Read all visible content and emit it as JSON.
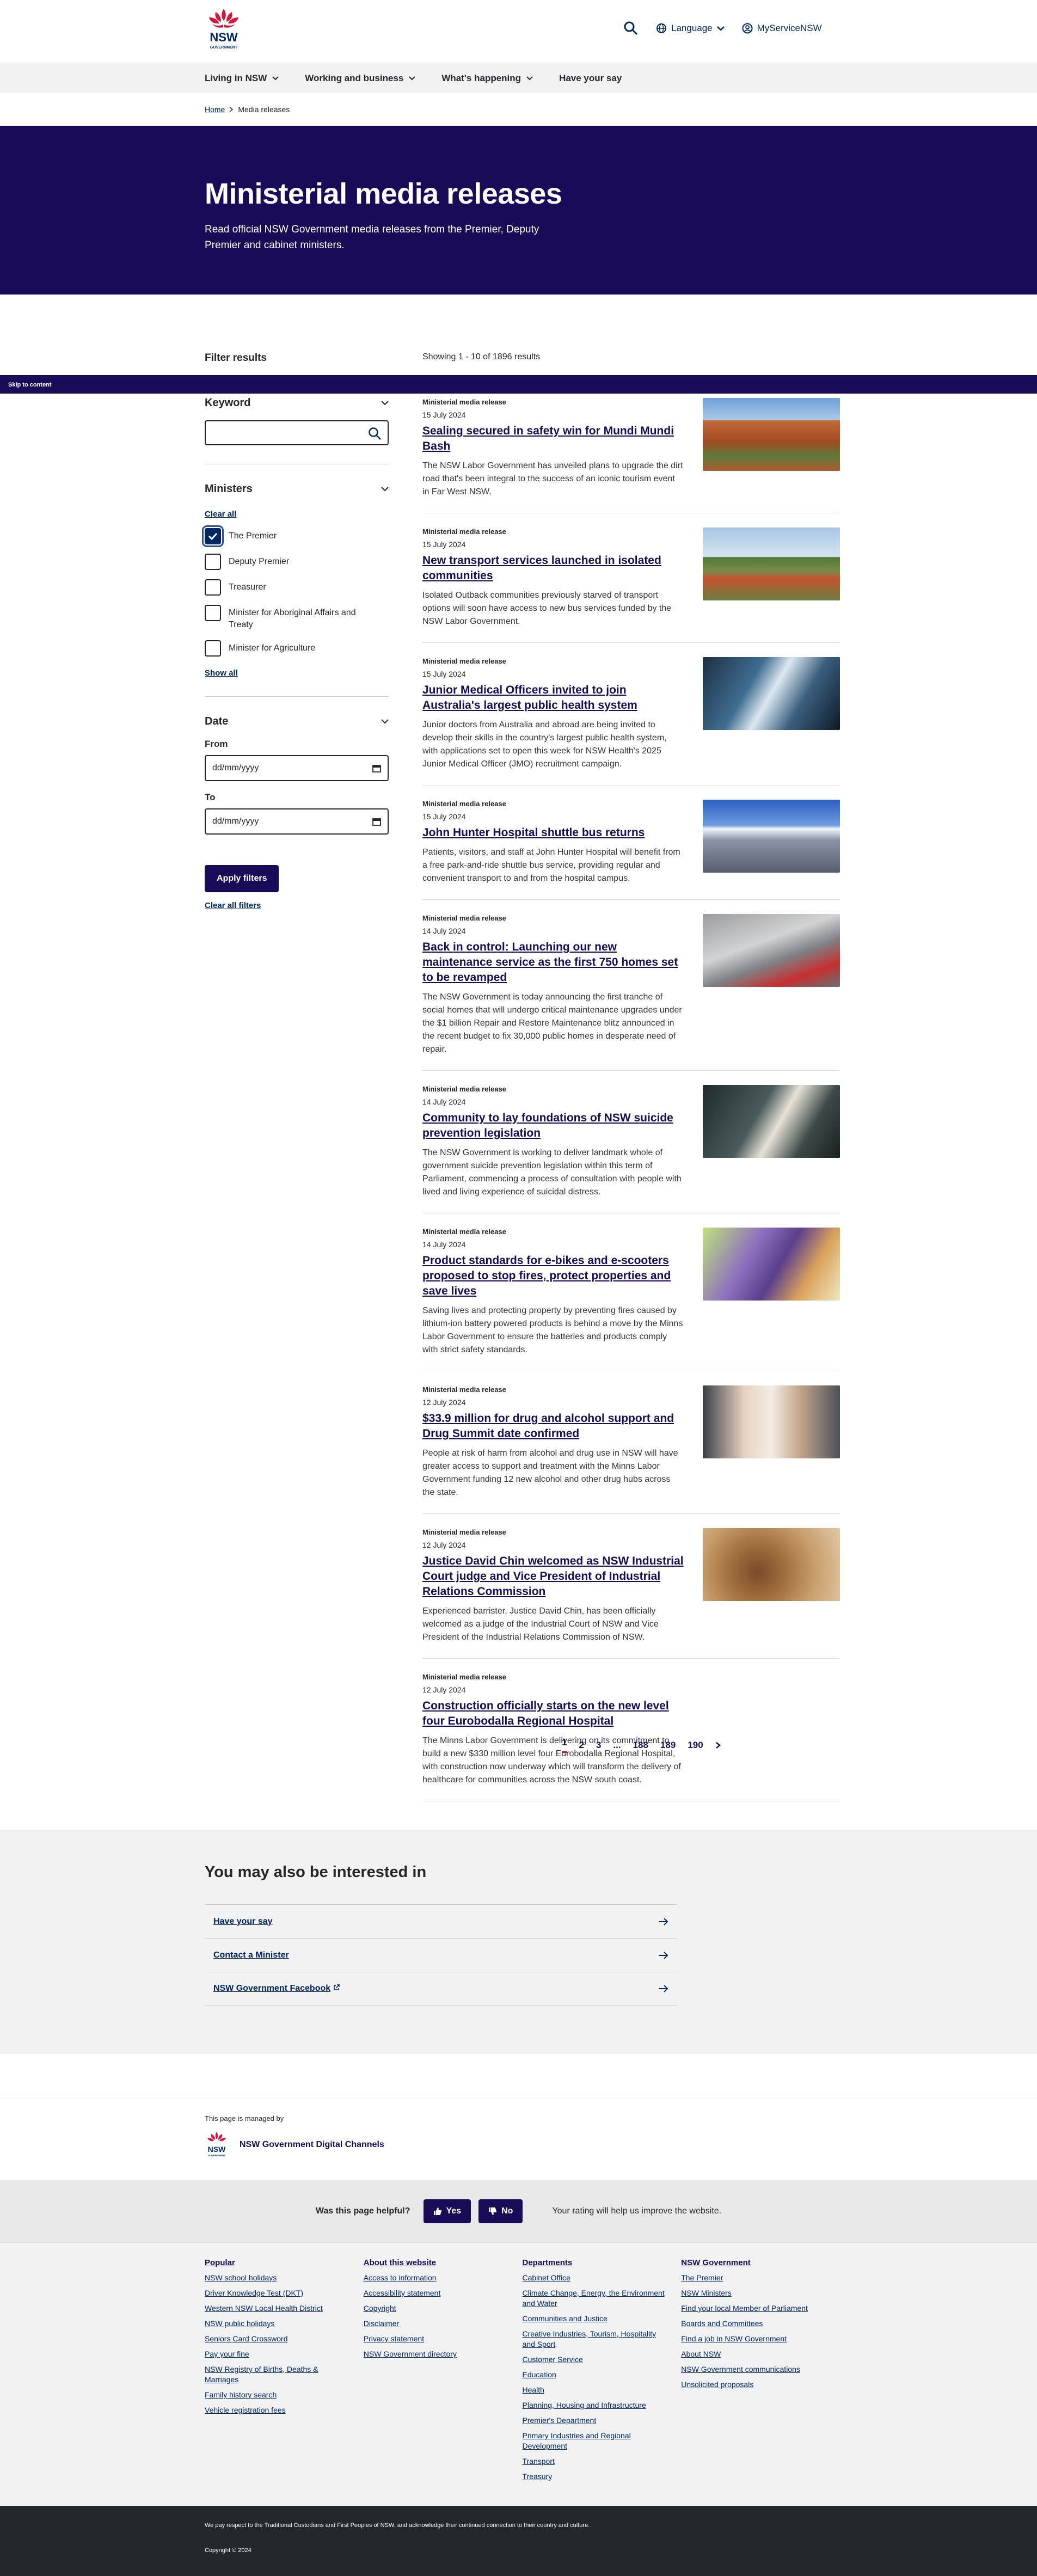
{
  "header": {
    "logo_text": "NSW",
    "logo_sub": "GOVERNMENT",
    "language": "Language",
    "my_service": "MyServiceNSW"
  },
  "nav": {
    "items": [
      "Living in NSW",
      "Working and business",
      "What's happening",
      "Have your say"
    ]
  },
  "breadcrumb": {
    "home": "Home",
    "current": "Media releases"
  },
  "hero": {
    "title": "Ministerial media releases",
    "lead": "Read official NSW Government media releases from the Premier, Deputy Premier and cabinet ministers."
  },
  "skip": "Skip to content",
  "filters": {
    "title": "Filter results",
    "keyword": "Keyword",
    "ministers": "Ministers",
    "clear_all": "Clear all",
    "options": [
      "The Premier",
      "Deputy Premier",
      "Treasurer",
      "Minister for Aboriginal Affairs and Treaty",
      "Minister for Agriculture"
    ],
    "show_all": "Show all",
    "date": "Date",
    "from": "From",
    "to": "To",
    "date_placeholder": "dd/mm/yyyy",
    "apply": "Apply filters",
    "clear_filters": "Clear all filters"
  },
  "showing": "Showing 1 - 10 of 1896 results",
  "results": [
    {
      "type": "Ministerial media release",
      "date": "15 July 2024",
      "title": "Sealing secured in safety win for Mundi Mundi Bash",
      "summary": "The NSW Labor Government has unveiled plans to upgrade the dirt road that's been integral to the success of an iconic tourism event in Far West NSW.",
      "img": "outback"
    },
    {
      "type": "Ministerial media release",
      "date": "15 July 2024",
      "title": "New transport services launched in isolated communities",
      "summary": "Isolated Outback communities previously starved of transport options will soon have access to new bus services funded by the NSW Labor Government.",
      "img": "road"
    },
    {
      "type": "Ministerial media release",
      "date": "15 July 2024",
      "title": "Junior Medical Officers invited to join Australia's largest public health system",
      "summary": "Junior doctors from Australia and abroad are being invited to develop their skills in the country's largest public health system, with applications set to open this week for NSW Health's 2025 Junior Medical Officer (JMO) recruitment campaign.",
      "img": "xray"
    },
    {
      "type": "Ministerial media release",
      "date": "15 July 2024",
      "title": "John Hunter Hospital shuttle bus returns",
      "summary": "Patients, visitors, and staff at John Hunter Hospital will benefit from a free park-and-ride shuttle bus service, providing regular and convenient transport to and from the hospital campus.",
      "img": "hospital"
    },
    {
      "type": "Ministerial media release",
      "date": "14 July 2024",
      "title": "Back in control: Launching our new maintenance service as the first 750 homes set to be revamped",
      "summary": "The NSW Government is today announcing the first tranche of social homes that will undergo critical maintenance upgrades under the $1 billion Repair and Restore Maintenance blitz announced in the recent budget to fix 30,000 public homes in desperate need of repair.",
      "img": "ceiling"
    },
    {
      "type": "Ministerial media release",
      "date": "14 July 2024",
      "title": "Community to lay foundations of NSW suicide prevention legislation",
      "summary": "The NSW Government is working to deliver landmark whole of government suicide prevention legislation within this term of Parliament, commencing a process of consultation with people with lived and living experience of suicidal distress.",
      "img": "coffee"
    },
    {
      "type": "Ministerial media release",
      "date": "14 July 2024",
      "title": "Product standards for e-bikes and e-scooters proposed to stop fires, protect properties and save lives",
      "summary": "Saving lives and protecting property by preventing fires caused by lithium-ion battery powered products is behind a move by the Minns Labor Government to ensure the batteries and products comply with strict safety standards.",
      "img": "bike"
    },
    {
      "type": "Ministerial media release",
      "date": "12 July 2024",
      "title": "$33.9 million for drug and alcohol support and Drug Summit date confirmed",
      "summary": "People at risk of harm from alcohol and drug use in NSW will have greater access to support and treatment with the Minns Labor Government funding 12 new alcohol and other drug hubs across the state.",
      "img": "support"
    },
    {
      "type": "Ministerial media release",
      "date": "12 July 2024",
      "title": "Justice David Chin welcomed as NSW Industrial Court judge and Vice President of Industrial Relations Commission",
      "summary": "Experienced barrister, Justice David Chin, has been officially welcomed as a judge of the Industrial Court of NSW and Vice President of the Industrial Relations Commission of NSW.",
      "img": "gavel"
    },
    {
      "type": "Ministerial media release",
      "date": "12 July 2024",
      "title": "Construction officially starts on the new level four Eurobodalla Regional Hospital",
      "summary": "The Minns Labor Government is delivering on its commitment to build a new $330 million level four Eurobodalla Regional Hospital, with construction now underway which will transform the delivery of healthcare for communities across the NSW south coast.",
      "img": ""
    }
  ],
  "pager": [
    "1",
    "2",
    "3",
    "...",
    "188",
    "189",
    "190"
  ],
  "interested": {
    "title": "You may also be interested in",
    "links": [
      "Have your say",
      "Contact a Minister",
      "NSW Government Facebook"
    ]
  },
  "managed": {
    "label": "This page is managed by",
    "org": "NSW Government Digital Channels"
  },
  "helpful": {
    "question": "Was this page helpful?",
    "yes": "Yes",
    "no": "No",
    "message": "Your rating will help us improve the website."
  },
  "footer": {
    "cols": [
      {
        "title": "Popular",
        "links": [
          "NSW school holidays",
          "Driver Knowledge Test (DKT)",
          "Western NSW Local Health District",
          "NSW public holidays",
          "Seniors Card Crossword",
          "Pay your fine",
          "NSW Registry of Births, Deaths & Marriages",
          "Family history search",
          "Vehicle registration fees"
        ]
      },
      {
        "title": "About this website",
        "links": [
          "Access to information",
          "Accessibility statement",
          "Copyright",
          "Disclaimer",
          "Privacy statement",
          "NSW Government directory"
        ]
      },
      {
        "title": "Departments",
        "links": [
          "Cabinet Office",
          "Climate Change, Energy, the Environment and Water",
          "Communities and Justice",
          "Creative Industries, Tourism, Hospitality and Sport",
          "Customer Service",
          "Education",
          "Health",
          "Planning, Housing and Infrastructure",
          "Premier's Department",
          "Primary Industries and Regional Development",
          "Transport",
          "Treasury"
        ]
      },
      {
        "title": "NSW Government",
        "links": [
          "The Premier",
          "NSW Ministers",
          "Find your local Member of Parliament",
          "Boards and Committees",
          "Find a job in NSW Government",
          "About NSW",
          "NSW Government communications",
          "Unsolicited proposals"
        ]
      }
    ],
    "acknowledgement": "We pay respect to the Traditional Custodians and First Peoples of NSW, and acknowledge their continued connection to their country and culture.",
    "copyright": "Copyright © 2024"
  }
}
